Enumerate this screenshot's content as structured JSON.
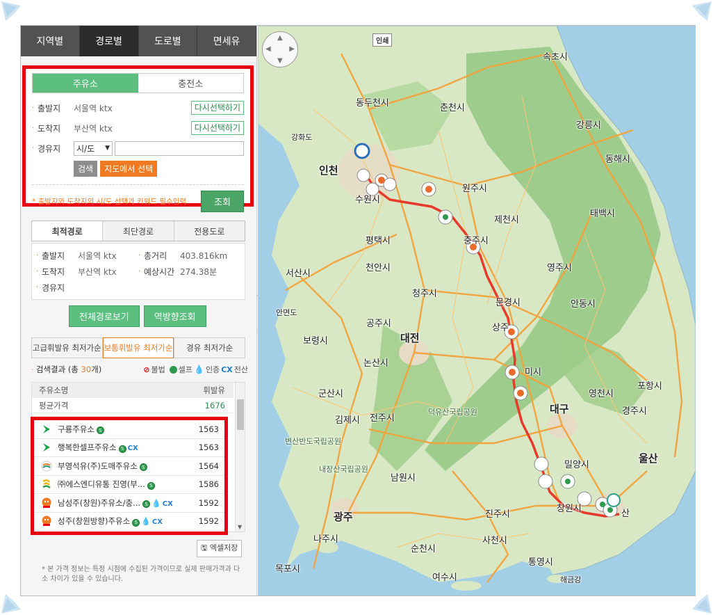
{
  "top_nav": [
    "지역별",
    "경로별",
    "도로별",
    "면세유"
  ],
  "search": {
    "type_tabs": [
      "주유소",
      "충전소"
    ],
    "origin_label": "출발지",
    "origin_value": "서울역 ktx",
    "dest_label": "도착지",
    "dest_value": "부산역 ktx",
    "via_label": "경유지",
    "select_value": "시/도",
    "reselect_label": "다시선택하기",
    "search_btn": "검색",
    "map_select_btn": "지도에서 선택",
    "notice": "* 출발지와 도착지의 시/도 선택과 키워드 필수입력",
    "submit_btn": "조회"
  },
  "route_tabs": [
    "최적경로",
    "최단경로",
    "전용도로"
  ],
  "route_info": {
    "origin_label": "출발지",
    "origin_value": "서울역 ktx",
    "dest_label": "도착지",
    "dest_value": "부산역 ktx",
    "via_label": "경유지",
    "distance_label": "총거리",
    "distance_value": "403.816km",
    "time_label": "예상시간",
    "time_value": "274.38분"
  },
  "route_btns": [
    "전체경로보기",
    "역방향조회"
  ],
  "price_tabs": [
    "고급휘발유 최저가순",
    "보통휘발유 최저가순",
    "경유 최저가순"
  ],
  "result": {
    "prefix": "검색결과 (총 ",
    "count": "30",
    "suffix": "개)",
    "legend": [
      "불법",
      "셀프",
      "인증",
      "전산"
    ]
  },
  "list": {
    "head_name": "주유소명",
    "head_price": "휘발유",
    "avg_label": "평균가격",
    "avg_value": "1676",
    "stations": [
      {
        "brand": "gs",
        "name": "구룡주유소",
        "price": "1563",
        "badges": [
          "self"
        ]
      },
      {
        "brand": "gs",
        "name": "행복한셀프주유소",
        "price": "1563",
        "badges": [
          "self",
          "card"
        ]
      },
      {
        "brand": "hd",
        "name": "부영석유(주)도매주유소",
        "price": "1564",
        "badges": [
          "self"
        ]
      },
      {
        "brand": "soil",
        "name": "㈜에스엔디유통 진영(부...",
        "price": "1586",
        "badges": [
          "self"
        ]
      },
      {
        "brand": "ex",
        "name": "남성주(창원)주유소/충...",
        "price": "1592",
        "badges": [
          "self",
          "drop",
          "card"
        ]
      },
      {
        "brand": "ex",
        "name": "성주(창원방향)주유소",
        "price": "1592",
        "badges": [
          "self",
          "drop",
          "card"
        ]
      }
    ]
  },
  "excel_btn": "엑셀저장",
  "footnote": "* 본 가격 정보는 특정 시점에 수집된 가격이므로 실제 판매가격과 다소 차이가 있을 수 있습니다.",
  "map": {
    "print_label": "인쇄",
    "labels": [
      {
        "text": "속초시"
      },
      {
        "text": "동두천시"
      },
      {
        "text": "춘천시"
      },
      {
        "text": "강릉시"
      },
      {
        "text": "강화도"
      },
      {
        "text": "동해시"
      },
      {
        "text": "인천"
      },
      {
        "text": "원주시"
      },
      {
        "text": "수원시"
      },
      {
        "text": "태백시"
      },
      {
        "text": "제천시"
      },
      {
        "text": "평택시"
      },
      {
        "text": "충주시"
      },
      {
        "text": "서산시"
      },
      {
        "text": "천안시"
      },
      {
        "text": "영주시"
      },
      {
        "text": "청주시"
      },
      {
        "text": "안면도"
      },
      {
        "text": "문경시"
      },
      {
        "text": "안동시"
      },
      {
        "text": "공주시"
      },
      {
        "text": "대전"
      },
      {
        "text": "보령시"
      },
      {
        "text": "상주"
      },
      {
        "text": "논산시"
      },
      {
        "text": "미시"
      },
      {
        "text": "포항시"
      },
      {
        "text": "군산시"
      },
      {
        "text": "영천시"
      },
      {
        "text": "대구"
      },
      {
        "text": "경주시"
      },
      {
        "text": "덕유산국립공원"
      },
      {
        "text": "김제시"
      },
      {
        "text": "전주시"
      },
      {
        "text": "변산반도국립공원"
      },
      {
        "text": "밀양시"
      },
      {
        "text": "울산"
      },
      {
        "text": "내장산국립공원"
      },
      {
        "text": "남원시"
      },
      {
        "text": "창원시"
      },
      {
        "text": "광주"
      },
      {
        "text": "진주시"
      },
      {
        "text": "산"
      },
      {
        "text": "나주시"
      },
      {
        "text": "사천시"
      },
      {
        "text": "순천시"
      },
      {
        "text": "통영시"
      },
      {
        "text": "목포시"
      },
      {
        "text": "여수시"
      },
      {
        "text": "해금강"
      }
    ]
  },
  "colors": {
    "accent_green": "#5cbf7f",
    "accent_orange": "#f07a22",
    "highlight_red": "#e60012",
    "route_red": "#e83a2a"
  }
}
